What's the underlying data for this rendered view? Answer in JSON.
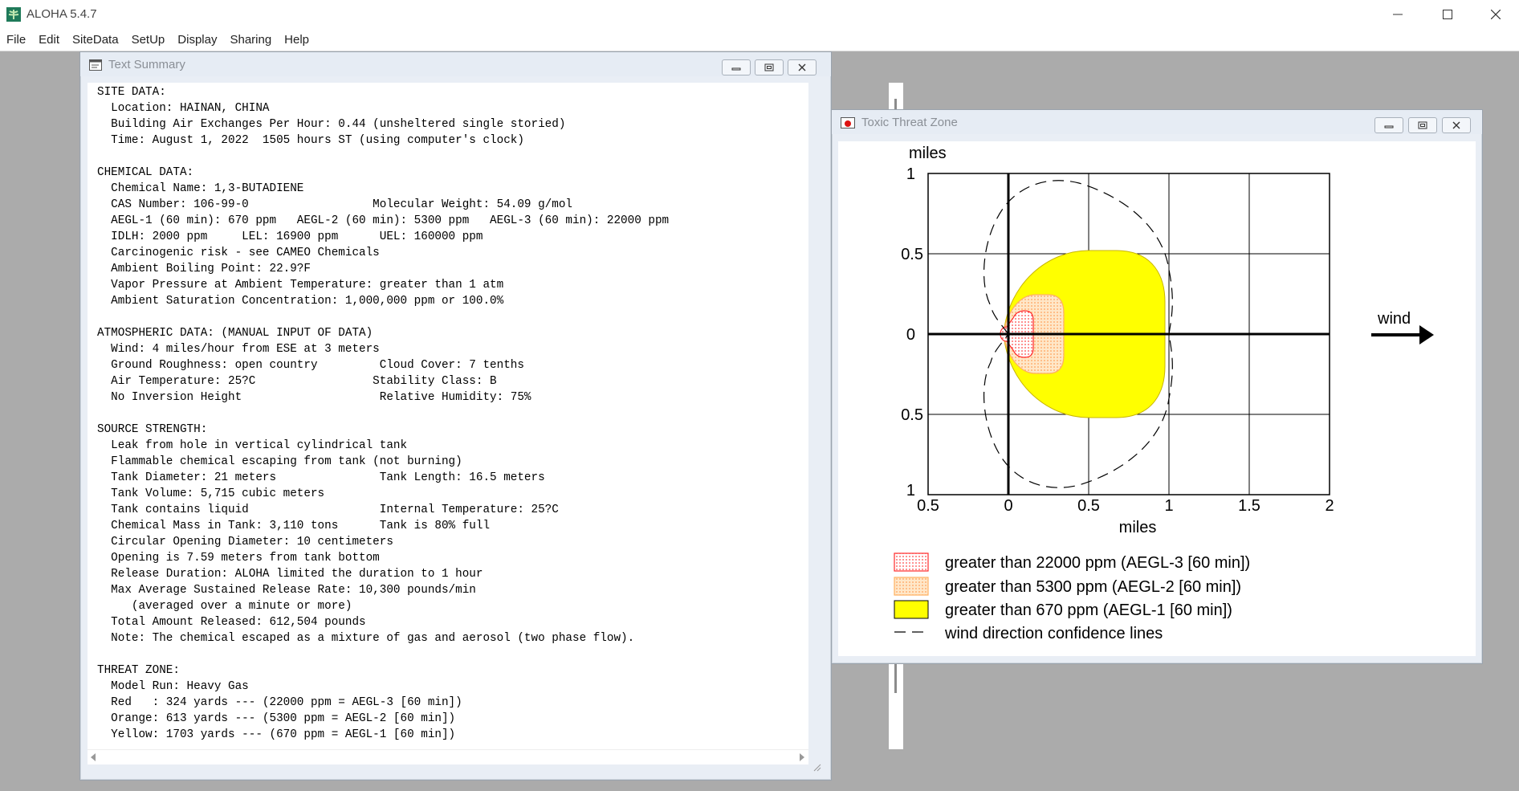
{
  "app": {
    "title": "ALOHA 5.4.7",
    "menu": [
      "File",
      "Edit",
      "SiteData",
      "SetUp",
      "Display",
      "Sharing",
      "Help"
    ]
  },
  "text_summary": {
    "title": "Text Summary",
    "lines": [
      "SITE DATA:",
      "  Location: HAINAN, CHINA",
      "  Building Air Exchanges Per Hour: 0.44 (unsheltered single storied)",
      "  Time: August 1, 2022  1505 hours ST (using computer's clock)",
      "",
      "CHEMICAL DATA:",
      "  Chemical Name: 1,3-BUTADIENE",
      "  CAS Number: 106-99-0                  Molecular Weight: 54.09 g/mol",
      "  AEGL-1 (60 min): 670 ppm   AEGL-2 (60 min): 5300 ppm   AEGL-3 (60 min): 22000 ppm",
      "  IDLH: 2000 ppm     LEL: 16900 ppm      UEL: 160000 ppm",
      "  Carcinogenic risk - see CAMEO Chemicals",
      "  Ambient Boiling Point: 22.9?F",
      "  Vapor Pressure at Ambient Temperature: greater than 1 atm",
      "  Ambient Saturation Concentration: 1,000,000 ppm or 100.0%",
      "",
      "ATMOSPHERIC DATA: (MANUAL INPUT OF DATA)",
      "  Wind: 4 miles/hour from ESE at 3 meters",
      "  Ground Roughness: open country         Cloud Cover: 7 tenths",
      "  Air Temperature: 25?C                 Stability Class: B",
      "  No Inversion Height                    Relative Humidity: 75%",
      "",
      "SOURCE STRENGTH:",
      "  Leak from hole in vertical cylindrical tank",
      "  Flammable chemical escaping from tank (not burning)",
      "  Tank Diameter: 21 meters               Tank Length: 16.5 meters",
      "  Tank Volume: 5,715 cubic meters",
      "  Tank contains liquid                   Internal Temperature: 25?C",
      "  Chemical Mass in Tank: 3,110 tons      Tank is 80% full",
      "  Circular Opening Diameter: 10 centimeters",
      "  Opening is 7.59 meters from tank bottom",
      "  Release Duration: ALOHA limited the duration to 1 hour",
      "  Max Average Sustained Release Rate: 10,300 pounds/min",
      "     (averaged over a minute or more)",
      "  Total Amount Released: 612,504 pounds",
      "  Note: The chemical escaped as a mixture of gas and aerosol (two phase flow).",
      "",
      "THREAT ZONE:",
      "  Model Run: Heavy Gas",
      "  Red   : 324 yards --- (22000 ppm = AEGL-3 [60 min])",
      "  Orange: 613 yards --- (5300 ppm = AEGL-2 [60 min])",
      "  Yellow: 1703 yards --- (670 ppm = AEGL-1 [60 min])"
    ]
  },
  "threat_zone": {
    "title": "Toxic Threat Zone",
    "y_unit_label": "miles",
    "x_unit_label": "miles",
    "wind_label": "wind",
    "x_ticks": [
      "0.5",
      "0",
      "0.5",
      "1",
      "1.5",
      "2"
    ],
    "y_ticks": [
      "1",
      "0.5",
      "0",
      "0.5",
      "1"
    ],
    "legend": [
      {
        "label": "greater than 22000 ppm (AEGL-3 [60 min])",
        "color": "#ff3333"
      },
      {
        "label": "greater than 5300 ppm (AEGL-2 [60 min])",
        "color": "#ffb27a"
      },
      {
        "label": "greater than 670 ppm (AEGL-1 [60 min])",
        "color": "#ffff00"
      },
      {
        "label": "wind direction confidence lines",
        "color": "#000000"
      }
    ]
  }
}
